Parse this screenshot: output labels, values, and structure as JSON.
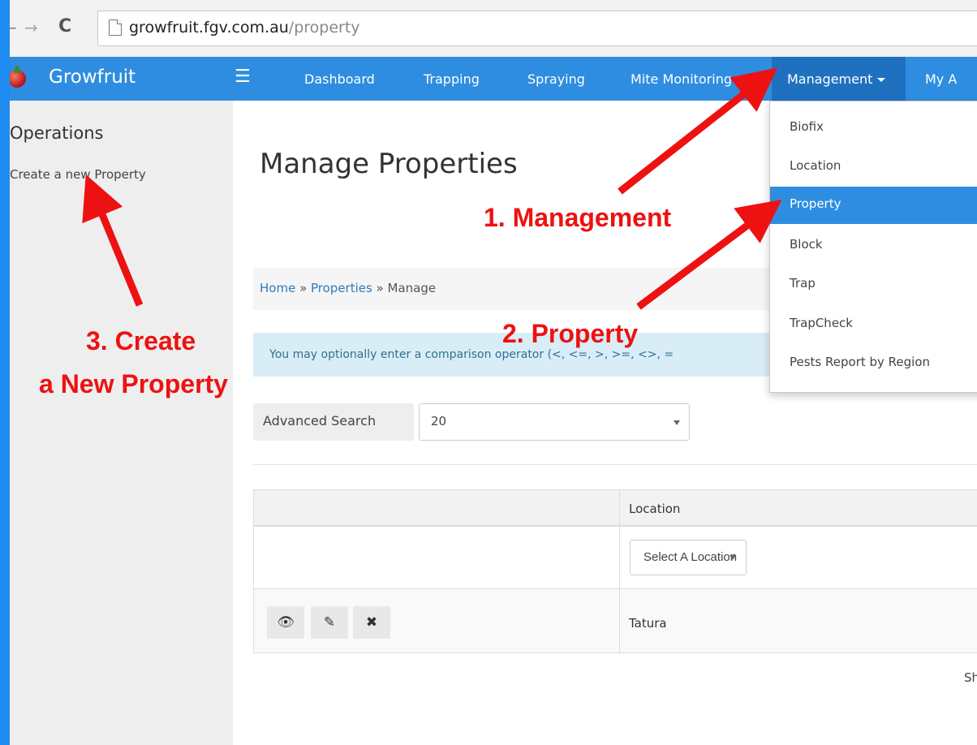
{
  "browser": {
    "url_host": "growfruit.fgv.com.au",
    "url_path": "/property"
  },
  "navbar": {
    "brand": "Growfruit",
    "links": [
      "Dashboard",
      "Trapping",
      "Spraying",
      "Mite Monitoring"
    ],
    "active_menu": "Management",
    "truncated_link": "My A"
  },
  "dropdown": {
    "items": [
      "Biofix",
      "Location",
      "Property",
      "Block",
      "Trap",
      "TrapCheck",
      "Pests Report by Region"
    ],
    "active_item": "Property"
  },
  "sidebar": {
    "heading": "Operations",
    "link": "Create a new Property"
  },
  "main": {
    "title": "Manage Properties",
    "breadcrumb": {
      "home": "Home",
      "sep": " » ",
      "properties": "Properties",
      "current": "Manage"
    },
    "info_text": "You may optionally enter a comparison operator (<, <=, >, >=, <>, =",
    "advanced_search_label": "Advanced Search",
    "page_size_value": "20",
    "table": {
      "column_location": "Location",
      "location_filter_placeholder": "Select A Location",
      "rows": [
        {
          "location": "Tatura"
        }
      ]
    },
    "showing_truncated": "Sh"
  },
  "annotations": {
    "step1": "1. Management",
    "step2": "2. Property",
    "step3_line1": "3. Create",
    "step3_line2": "a New Property",
    "color": "#ee1111"
  },
  "colors": {
    "navbar": "#2e8de0",
    "nav_active": "#1f71c0",
    "frame_border": "#1e8cf0"
  }
}
